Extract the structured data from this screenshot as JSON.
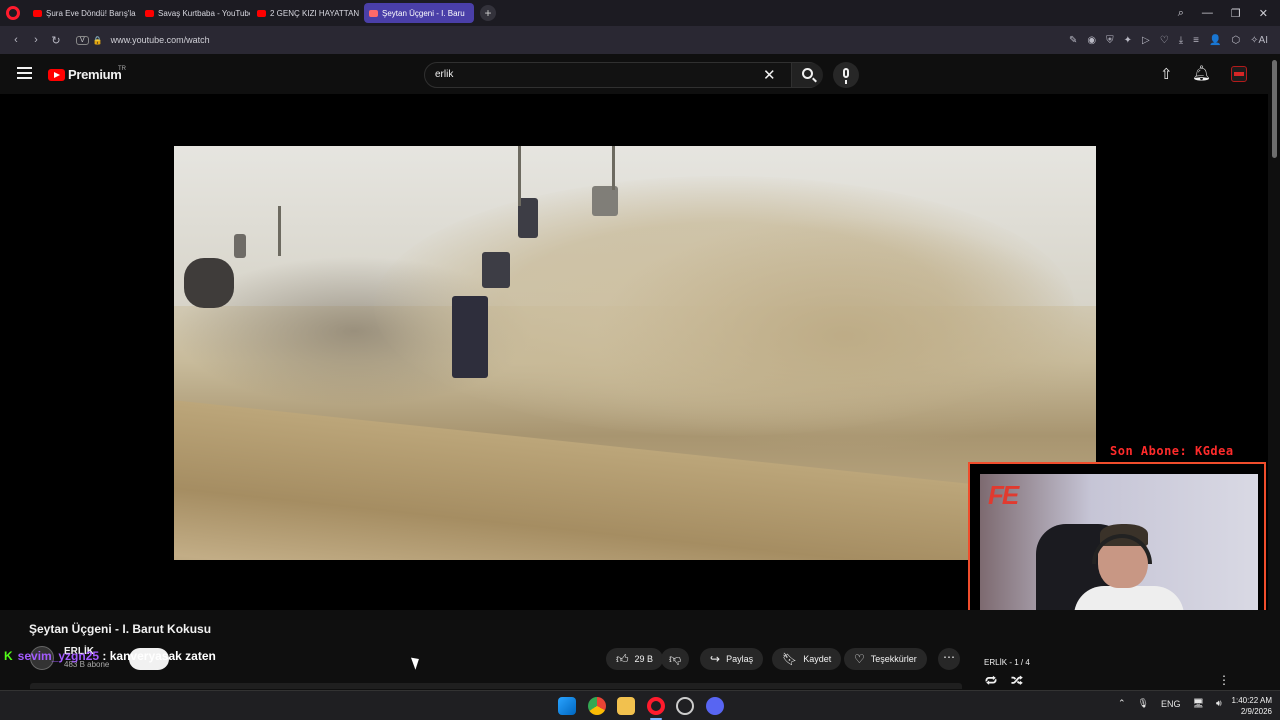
{
  "browser": {
    "tabs": [
      {
        "label": "Şura Eve Döndü! Barış'la B",
        "active": false
      },
      {
        "label": "Savaş Kurtbaba - YouTube",
        "active": false
      },
      {
        "label": "2 GENÇ KIZI HAYATTAN K",
        "active": false
      },
      {
        "label": "Şeytan Üçgeni - I. Baru",
        "active": true
      }
    ],
    "url_chip": "V",
    "url": "www.youtube.com/watch",
    "ai_label": "AI"
  },
  "youtube": {
    "brand": "Premium",
    "region": "TR",
    "search": {
      "value": "erlik"
    }
  },
  "video": {
    "title": "Şeytan Üçgeni - I. Barut Kokusu",
    "channel_name": "ERLİK",
    "subscribers": "483 B abone",
    "likes": "29 B",
    "share_label": "Paylaş",
    "save_label": "Kaydet",
    "thanks_label": "Teşekkürler"
  },
  "playlist": {
    "title": "ERLİK",
    "position": "1 / 4"
  },
  "stream_overlay": {
    "subscriber_banner": "Son Abone: KGdea",
    "chat_badge": "K",
    "chat_user": "sevim_yzgn25",
    "chat_separator": ":",
    "chat_message": "kanveryasak zaten",
    "logo_text": "FE"
  },
  "taskbar": {
    "language": "ENG",
    "time": "1:40:22 AM",
    "date": "2/9/2026"
  },
  "colors": {
    "yt_red": "#ff0000",
    "browser_accent": "#4a3fa8",
    "overlay_red": "#ff2b2b",
    "chat_user": "#a35bff",
    "chat_badge": "#53fc18"
  }
}
